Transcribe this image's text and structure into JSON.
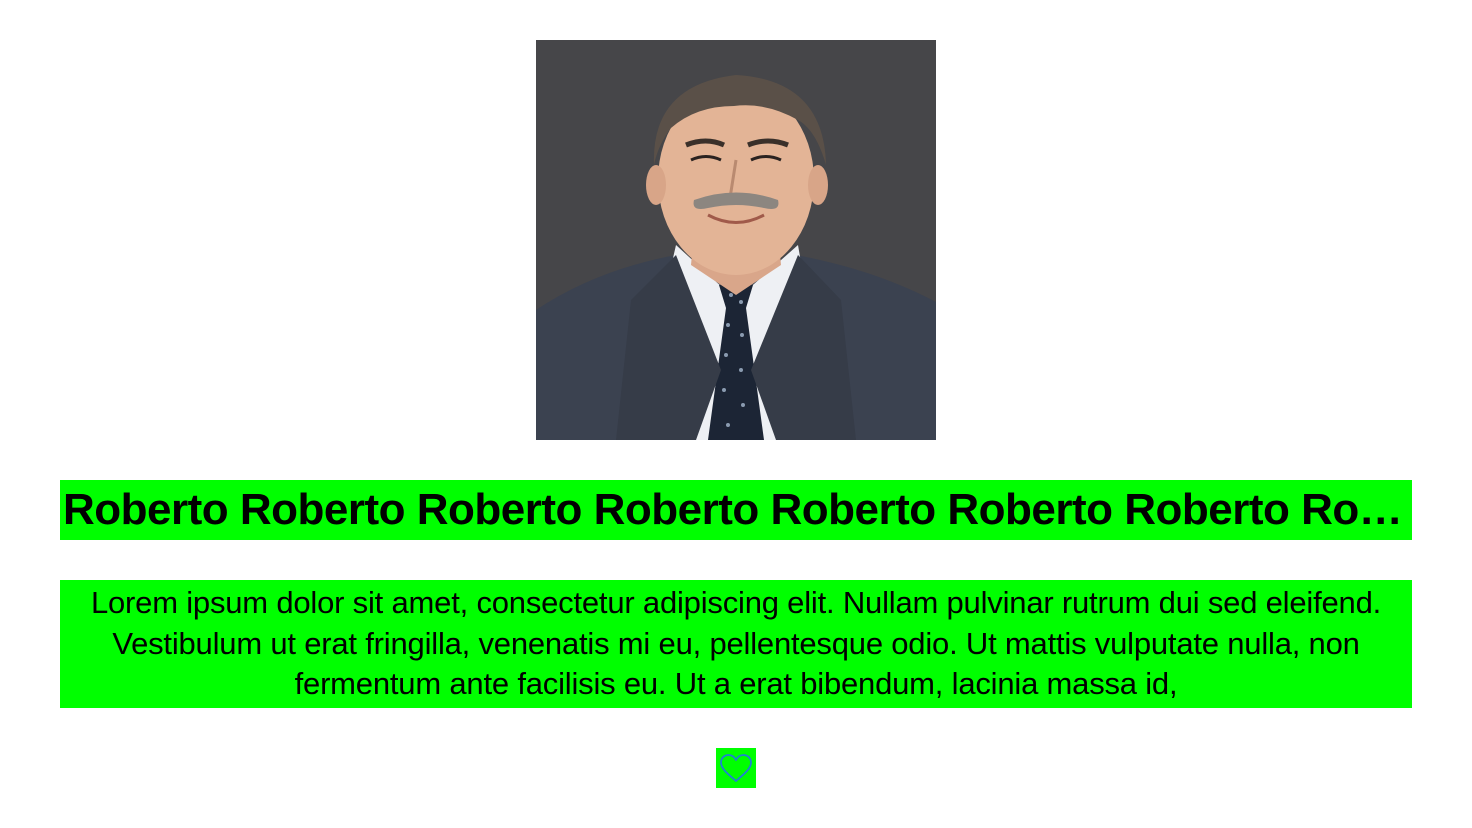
{
  "profile": {
    "name": "Roberto Roberto Roberto Roberto Roberto Roberto Roberto Roberto Roberto Roberto",
    "description": "Lorem ipsum dolor sit amet, consectetur adipiscing elit. Nullam pulvinar rutrum dui sed eleifend. Vestibulum ut erat fringilla, venenatis mi eu, pellentesque odio. Ut mattis vulputate nulla, non fermentum ante facilisis eu. Ut a erat bibendum, lacinia massa id,",
    "photo_alt": "Portrait photo",
    "like_icon": "heart-outline-icon"
  },
  "colors": {
    "highlight": "#00ff00",
    "heart_stroke": "#1f7fd6"
  }
}
